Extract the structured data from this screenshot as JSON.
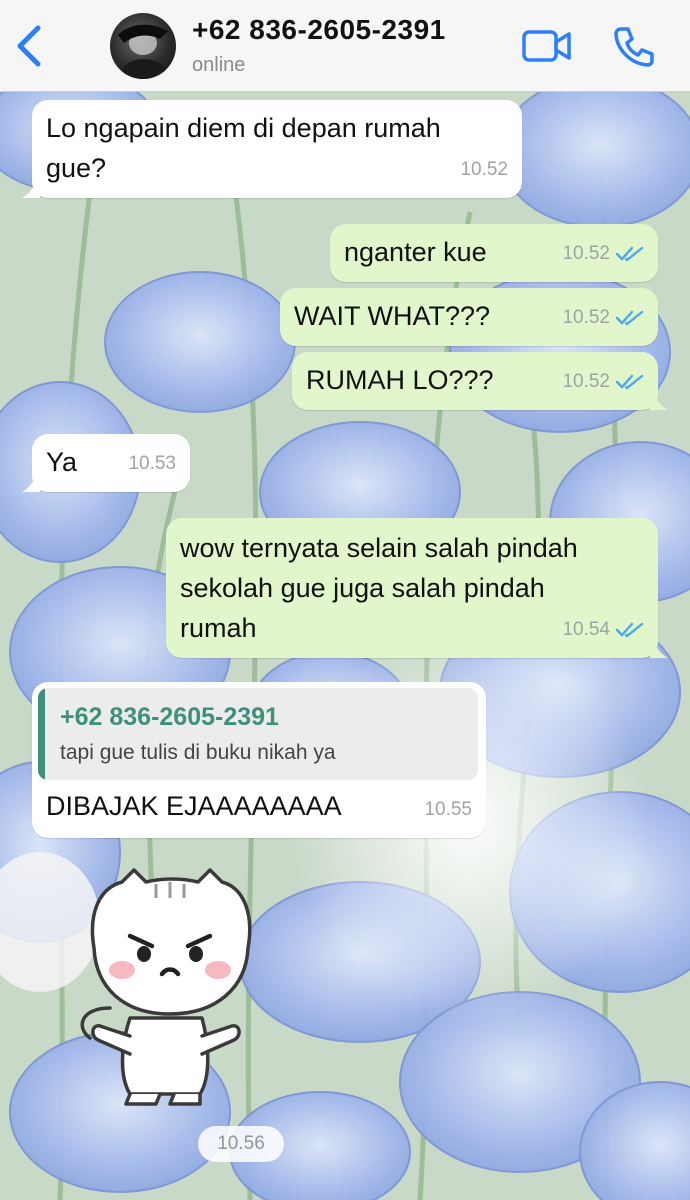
{
  "header": {
    "contact_name": "+62 836-2605-2391",
    "status": "online",
    "back_icon": "chevron-left-icon",
    "video_icon": "video-camera-icon",
    "call_icon": "phone-icon",
    "accent_color": "#2d7ff9"
  },
  "messages": [
    {
      "direction": "in",
      "text_lines": [
        "Lo ngapain diem di depan rumah",
        "gue?"
      ],
      "time": "10.52"
    },
    {
      "direction": "out",
      "text": "nganter kue",
      "time": "10.52",
      "status": "read"
    },
    {
      "direction": "out",
      "text": "WAIT WHAT???",
      "time": "10.52",
      "status": "read"
    },
    {
      "direction": "out",
      "text": "RUMAH LO???",
      "time": "10.52",
      "status": "read"
    },
    {
      "direction": "in",
      "text": "Ya",
      "time": "10.53"
    },
    {
      "direction": "out",
      "text_lines": [
        "wow ternyata selain salah pindah",
        "sekolah gue juga salah pindah",
        "rumah"
      ],
      "time": "10.54",
      "status": "read"
    },
    {
      "direction": "in",
      "reply_to": {
        "author": "+62 836-2605-2391",
        "text": "tapi gue tulis di buku nikah ya"
      },
      "text": "DIBAJAK EJAAAAAAAA",
      "time": "10.55"
    },
    {
      "direction": "in",
      "type": "sticker",
      "sticker": "angry-white-cat-sticker",
      "time": "10.56"
    }
  ],
  "colors": {
    "incoming_bubble": "#ffffff",
    "outgoing_bubble": "#e1f7cb",
    "read_ticks": "#4fa8e8",
    "quote_accent": "#3e8f7c"
  }
}
